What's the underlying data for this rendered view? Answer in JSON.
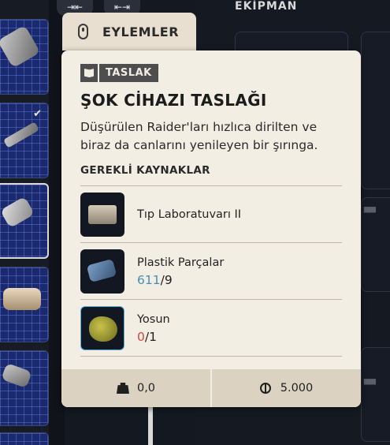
{
  "top_buttons": {
    "collapse_glyph": "⇥⇤",
    "split_glyph": "⇤⇥"
  },
  "actions_tab": {
    "label": "EYLEMLER",
    "icon": "mouse-icon"
  },
  "equipment_header": {
    "label": "EKİPMAN"
  },
  "inventory_slots": [
    {
      "icon": "canister-icon",
      "checked": false,
      "active": false
    },
    {
      "icon": "syringe-icon",
      "checked": true,
      "active": false
    },
    {
      "icon": "drone-icon",
      "checked": false,
      "active": true
    },
    {
      "icon": "barrel-icon",
      "checked": false,
      "active": false
    },
    {
      "icon": "cartridge-icon",
      "checked": false,
      "active": false
    }
  ],
  "checkmark_glyph": "✔",
  "card": {
    "badge_label": "TASLAK",
    "title": "ŞOK CİHAZI TASLAĞI",
    "description": "Düşürülen Raider'ları hızlıca dirilten ve biraz da canlarını yenileyen bir şırınga.",
    "requirements_heading": "GEREKLİ KAYNAKLAR",
    "resources": [
      {
        "name": "Tıp Laboratuvarı II",
        "icon": "medical-lab-icon"
      },
      {
        "name": "Plastik Parçalar",
        "icon": "plastic-parts-icon",
        "have": "611",
        "need": "/9",
        "status": "ok"
      },
      {
        "name": "Yosun",
        "icon": "moss-icon",
        "have": "0",
        "need": "/1",
        "status": "missing"
      }
    ],
    "footer": {
      "weight": "0,0",
      "weight_icon": "bag-icon",
      "price": "5.000",
      "price_icon": "coin-icon"
    }
  },
  "colors": {
    "card_bg": "#f3eee4",
    "footer_bg": "#dcd2c1",
    "badge_bg": "#4e4e4e",
    "qty_ok": "#4a8fb0",
    "qty_missing": "#d24a3a",
    "slot_blue": "#1b2a6e"
  }
}
